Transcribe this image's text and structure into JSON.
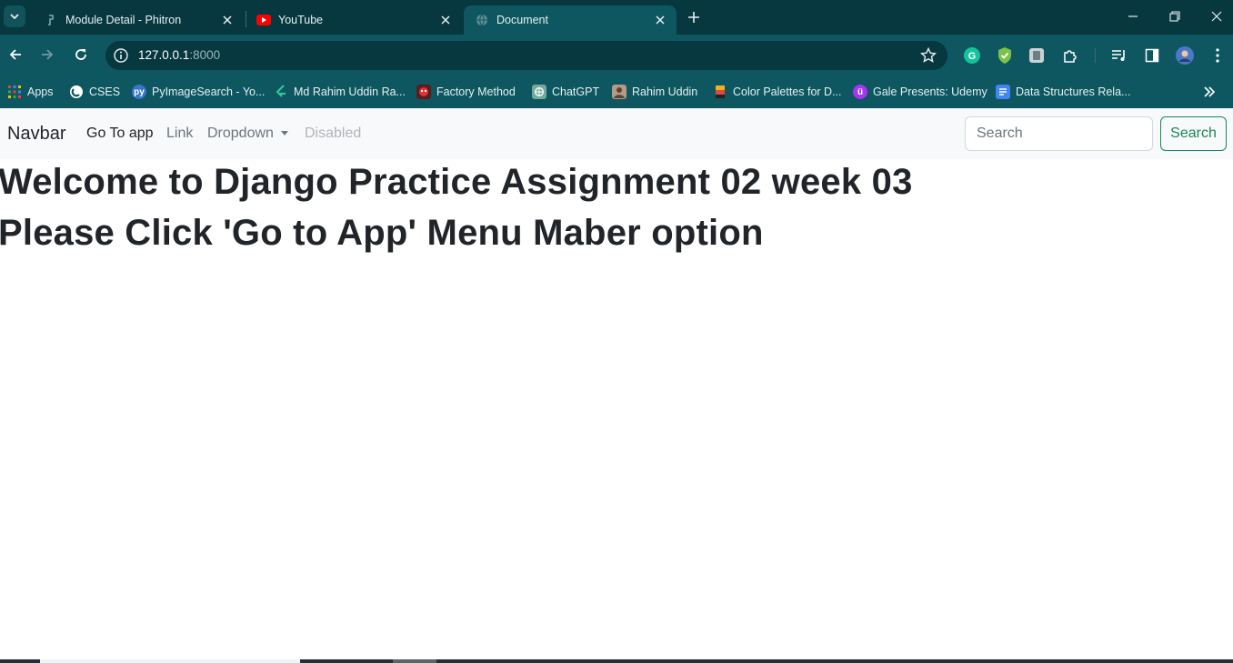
{
  "browser": {
    "tabs": [
      {
        "title": "Module Detail - Phitron",
        "icon": "phitron-icon",
        "active": false
      },
      {
        "title": "YouTube",
        "icon": "youtube-icon",
        "active": false
      },
      {
        "title": "Document",
        "icon": "globe-icon",
        "active": true
      }
    ],
    "address": {
      "host": "127.0.0.1",
      "port": ":8000"
    },
    "bookmarks": [
      {
        "label": "Apps",
        "icon": "apps-grid-icon"
      },
      {
        "label": "CSES",
        "icon": "cses-icon"
      },
      {
        "label": "PyImageSearch - Yo...",
        "icon": "pyimagesearch-icon"
      },
      {
        "label": "Md Rahim Uddin Ra...",
        "icon": "leetcode-icon"
      },
      {
        "label": "Factory Method",
        "icon": "refactoring-icon"
      },
      {
        "label": "ChatGPT",
        "icon": "chatgpt-icon"
      },
      {
        "label": "Rahim Uddin",
        "icon": "profile-photo-icon"
      },
      {
        "label": "Color Palettes for D...",
        "icon": "color-palette-icon"
      },
      {
        "label": "Gale Presents: Udemy",
        "icon": "udemy-icon"
      },
      {
        "label": "Data Structures Rela...",
        "icon": "docs-icon"
      }
    ]
  },
  "navbar": {
    "brand": "Navbar",
    "links": [
      {
        "label": "Go To app",
        "state": "active"
      },
      {
        "label": "Link",
        "state": "normal"
      },
      {
        "label": "Dropdown",
        "state": "dropdown"
      },
      {
        "label": "Disabled",
        "state": "disabled"
      }
    ],
    "search": {
      "placeholder": "Search",
      "value": "",
      "button_label": "Search"
    }
  },
  "content": {
    "heading_1": "Welcome to Django Practice Assignment 02 week 03",
    "heading_2": "Please Click 'Go to App' Menu Maber option"
  },
  "colors": {
    "chrome_dark": "#07373f",
    "chrome_mid": "#0e5660",
    "navbar_bg": "#f8f9fa",
    "text": "#212529",
    "success": "#198754"
  }
}
